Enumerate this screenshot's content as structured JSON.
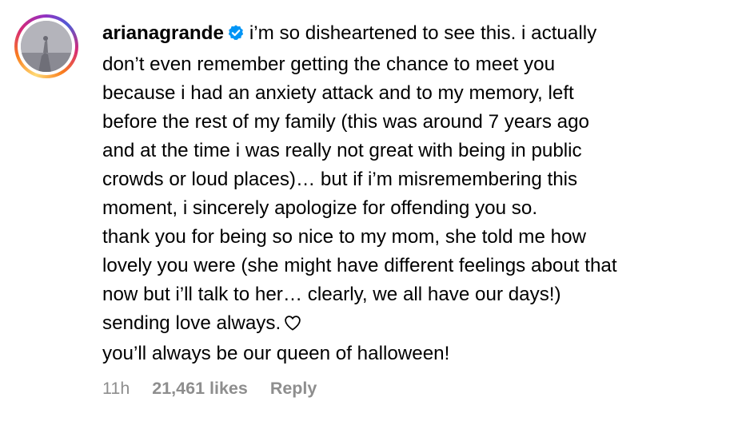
{
  "comment": {
    "username": "arianagrande",
    "verified": true,
    "lines": [
      "i’m so disheartened to see this. i actually",
      "don’t even remember getting the chance to meet you",
      "because i had an anxiety attack and to my memory, left",
      "before the rest of my family (this was around 7 years ago",
      "and at the time i was really not great with being in public",
      "crowds or loud places)… but if i’m misremembering this",
      "moment, i sincerely apologize for offending you so.",
      "thank you for being so nice to my mom, she told me how",
      "lovely you were (she might have different feelings about that",
      "now but i’ll talk to her… clearly, we all have our days!)",
      "sending love always.",
      "you’ll always be our queen of halloween!"
    ],
    "timestamp": "11h",
    "likes": "21,461 likes",
    "reply_label": "Reply"
  },
  "colors": {
    "text": "#000000",
    "meta": "#8e8e8e",
    "verified_badge": "#0095f6"
  },
  "icons": {
    "verified": "verified-badge-icon",
    "heart": "heart-outline-icon"
  }
}
